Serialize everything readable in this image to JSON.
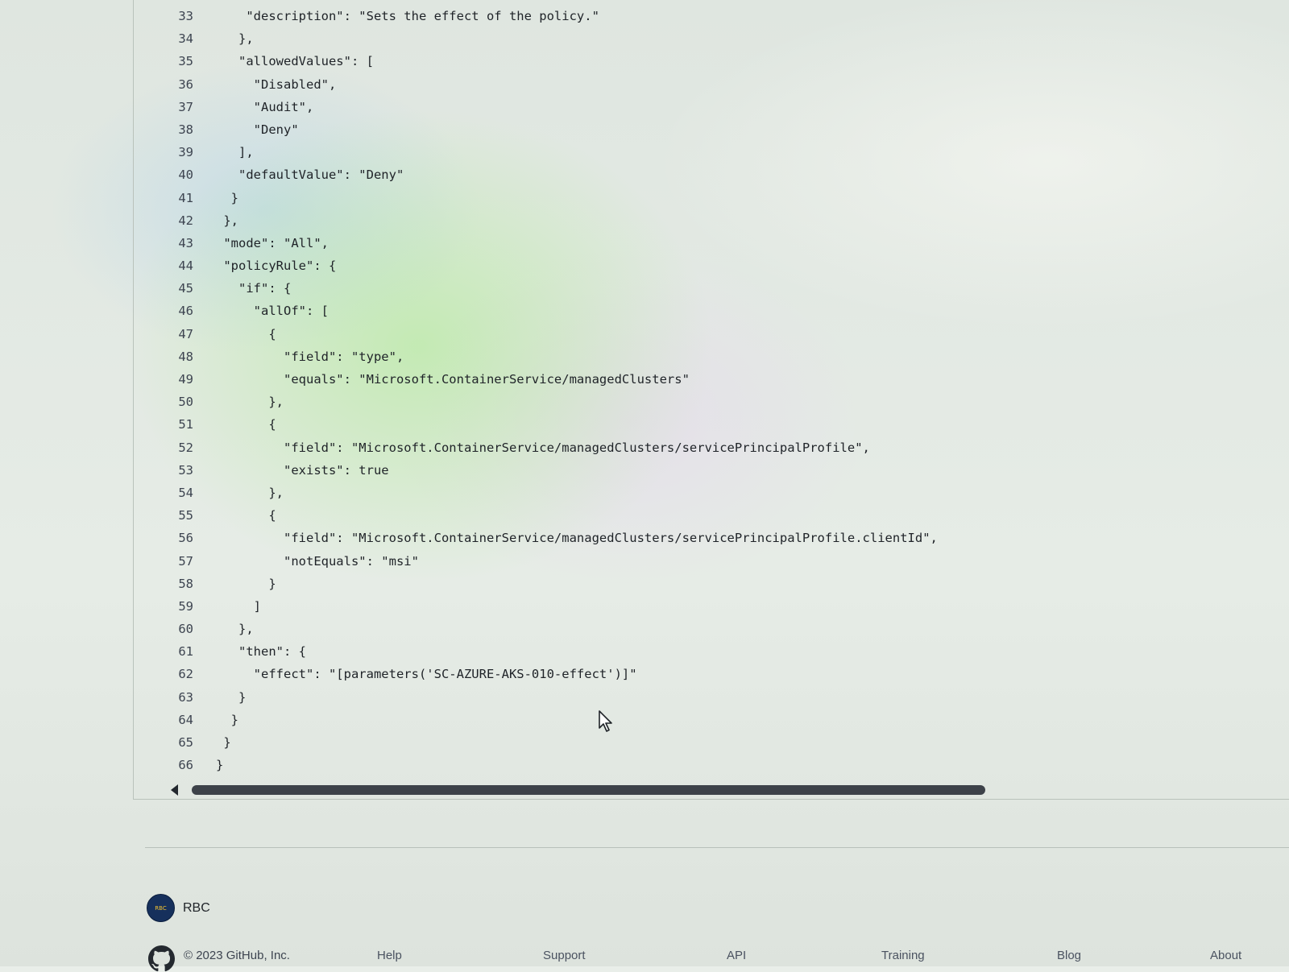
{
  "code": {
    "lines": [
      {
        "n": "33",
        "text": "    \"description\": \"Sets the effect of the policy.\""
      },
      {
        "n": "34",
        "text": "   },"
      },
      {
        "n": "35",
        "text": "   \"allowedValues\": ["
      },
      {
        "n": "36",
        "text": "     \"Disabled\","
      },
      {
        "n": "37",
        "text": "     \"Audit\","
      },
      {
        "n": "38",
        "text": "     \"Deny\""
      },
      {
        "n": "39",
        "text": "   ],"
      },
      {
        "n": "40",
        "text": "   \"defaultValue\": \"Deny\""
      },
      {
        "n": "41",
        "text": "  }"
      },
      {
        "n": "42",
        "text": " },"
      },
      {
        "n": "43",
        "text": " \"mode\": \"All\","
      },
      {
        "n": "44",
        "text": " \"policyRule\": {"
      },
      {
        "n": "45",
        "text": "   \"if\": {"
      },
      {
        "n": "46",
        "text": "     \"allOf\": ["
      },
      {
        "n": "47",
        "text": "       {"
      },
      {
        "n": "48",
        "text": "         \"field\": \"type\","
      },
      {
        "n": "49",
        "text": "         \"equals\": \"Microsoft.ContainerService/managedClusters\""
      },
      {
        "n": "50",
        "text": "       },"
      },
      {
        "n": "51",
        "text": "       {"
      },
      {
        "n": "52",
        "text": "         \"field\": \"Microsoft.ContainerService/managedClusters/servicePrincipalProfile\","
      },
      {
        "n": "53",
        "text": "         \"exists\": true"
      },
      {
        "n": "54",
        "text": "       },"
      },
      {
        "n": "55",
        "text": "       {"
      },
      {
        "n": "56",
        "text": "         \"field\": \"Microsoft.ContainerService/managedClusters/servicePrincipalProfile.clientId\","
      },
      {
        "n": "57",
        "text": "         \"notEquals\": \"msi\""
      },
      {
        "n": "58",
        "text": "       }"
      },
      {
        "n": "59",
        "text": "     ]"
      },
      {
        "n": "60",
        "text": "   },"
      },
      {
        "n": "61",
        "text": "   \"then\": {"
      },
      {
        "n": "62",
        "text": "     \"effect\": \"[parameters('SC-AZURE-AKS-010-effect')]\""
      },
      {
        "n": "63",
        "text": "   }"
      },
      {
        "n": "64",
        "text": "  }"
      },
      {
        "n": "65",
        "text": " }"
      },
      {
        "n": "66",
        "text": "}"
      }
    ]
  },
  "org": {
    "name": "RBC",
    "avatar_text": "RBC"
  },
  "footer": {
    "copyright": "© 2023 GitHub, Inc.",
    "links": [
      "Help",
      "Support",
      "API",
      "Training",
      "Blog",
      "About"
    ]
  },
  "icons": {
    "github": "github-mark-icon",
    "scroll_left": "scroll-left-arrow-icon",
    "cursor": "mouse-pointer-icon"
  }
}
